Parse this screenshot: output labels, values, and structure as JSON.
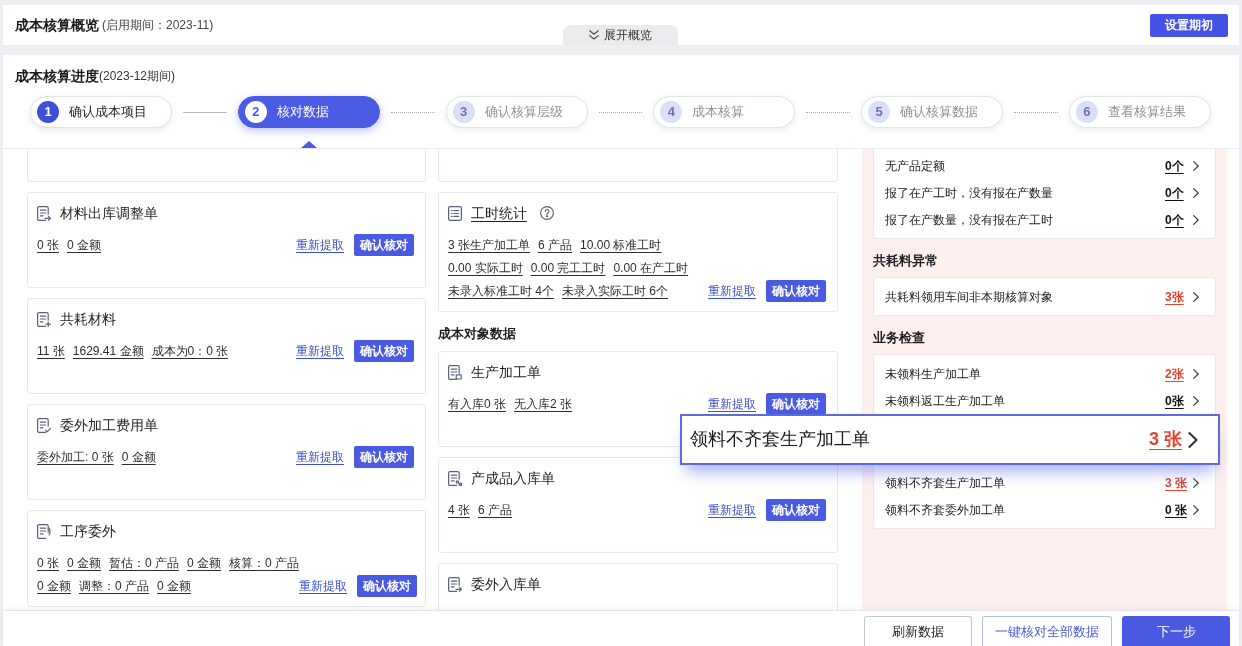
{
  "overview": {
    "title": "成本核算概览",
    "period": "(启用期间：2023-11)",
    "setup_button": "设置期初",
    "expand_tab": "展开概览"
  },
  "progress": {
    "title": "成本核算进度",
    "period": "(2023-12期间)",
    "steps": [
      {
        "number": "1",
        "label": "确认成本项目",
        "completed": true,
        "selected": false
      },
      {
        "number": "2",
        "label": "核对数据",
        "completed": false,
        "selected": true
      },
      {
        "number": "3",
        "label": "确认核算层级",
        "completed": false,
        "selected": false
      },
      {
        "number": "4",
        "label": "成本核算",
        "completed": false,
        "selected": false
      },
      {
        "number": "5",
        "label": "确认核算数据",
        "completed": false,
        "selected": false
      },
      {
        "number": "6",
        "label": "查看核算结果",
        "completed": false,
        "selected": false
      }
    ]
  },
  "left_column": {
    "items": [
      {
        "kind": "partial"
      },
      {
        "kind": "card",
        "title": "材料出库调整单",
        "lines": [
          [
            "0 张",
            "0 金额"
          ]
        ],
        "refetch": "重新提取",
        "confirm": "确认核对"
      },
      {
        "kind": "card",
        "title": "共耗材料",
        "lines": [
          [
            "11 张",
            "1629.41 金额",
            "成本为0：0 张"
          ]
        ],
        "refetch": "重新提取",
        "confirm": "确认核对"
      },
      {
        "kind": "card",
        "title": "委外加工费用单",
        "lines": [
          [
            "委外加工: 0 张",
            "0 金额"
          ]
        ],
        "refetch": "重新提取",
        "confirm": "确认核对"
      },
      {
        "kind": "card",
        "title": "工序委外",
        "lines": [
          [
            "0 张",
            "0 金额",
            "暂估：0 产品",
            "0 金额",
            "核算：0 产品"
          ],
          [
            "0 金额",
            "调整：0 产品",
            "0 金额"
          ]
        ],
        "refetch": "重新提取",
        "confirm": "确认核对"
      }
    ]
  },
  "middle_column": {
    "items": [
      {
        "kind": "partial"
      },
      {
        "kind": "card",
        "title": "工时统计",
        "title_link": true,
        "help": true,
        "lines": [
          [
            "3 张生产加工单",
            "6 产品",
            "10.00 标准工时"
          ],
          [
            "0.00 实际工时",
            "0.00 完工工时",
            "0.00 在产工时"
          ],
          [
            "未录入标准工时 4个",
            "未录入实际工时 6个"
          ]
        ],
        "refetch": "重新提取",
        "confirm": "确认核对"
      },
      {
        "kind": "heading",
        "text": "成本对象数据"
      },
      {
        "kind": "card",
        "title": "生产加工单",
        "title_link": false,
        "help": false,
        "lines": [
          [
            "有入库0 张",
            "无入库2 张"
          ]
        ],
        "refetch": "重新提取",
        "confirm": "确认核对"
      },
      {
        "kind": "card",
        "title": "产成品入库单",
        "title_link": false,
        "help": false,
        "lines": [
          [
            "4 张",
            "6 产品"
          ]
        ],
        "refetch": "重新提取",
        "confirm": "确认核对"
      },
      {
        "kind": "card",
        "title": "委外入库单",
        "title_link": false,
        "help": false
      }
    ]
  },
  "right_panel": {
    "groups": [
      {
        "rows": [
          {
            "kind": "row",
            "label": "无产品定额",
            "count": "0个",
            "alert": false
          },
          {
            "kind": "row",
            "label": "报了在产工时，没有报在产数量",
            "count": "0个",
            "alert": false
          },
          {
            "kind": "row",
            "label": "报了在产数量，没有报在产工时",
            "count": "0个",
            "alert": false
          }
        ]
      },
      {
        "heading": "共耗料异常",
        "rows": [
          {
            "kind": "row",
            "label": "共耗料领用车间非本期核算对象",
            "count": "3张",
            "alert": true
          }
        ]
      },
      {
        "heading": "业务检查",
        "rows": [
          {
            "kind": "row",
            "label": "未领料生产加工单",
            "count": "2张",
            "alert": true
          },
          {
            "kind": "row",
            "label": "未领料返工生产加工单",
            "count": "0张",
            "alert": false
          },
          {
            "kind": "callout",
            "label": "领料不齐套生产加工单",
            "count": "3 张",
            "alert": true
          },
          {
            "kind": "row",
            "label": "领料不齐套生产加工单",
            "count": "3 张",
            "alert": true
          },
          {
            "kind": "row",
            "label": "领料不齐套委外加工单",
            "count": "0 张",
            "alert": false
          }
        ]
      }
    ]
  },
  "footer": {
    "buttons": [
      {
        "label": "刷新数据",
        "kind": "default"
      },
      {
        "label": "一键核对全部数据",
        "kind": "outline"
      },
      {
        "label": "下一步",
        "kind": "primary"
      }
    ]
  }
}
